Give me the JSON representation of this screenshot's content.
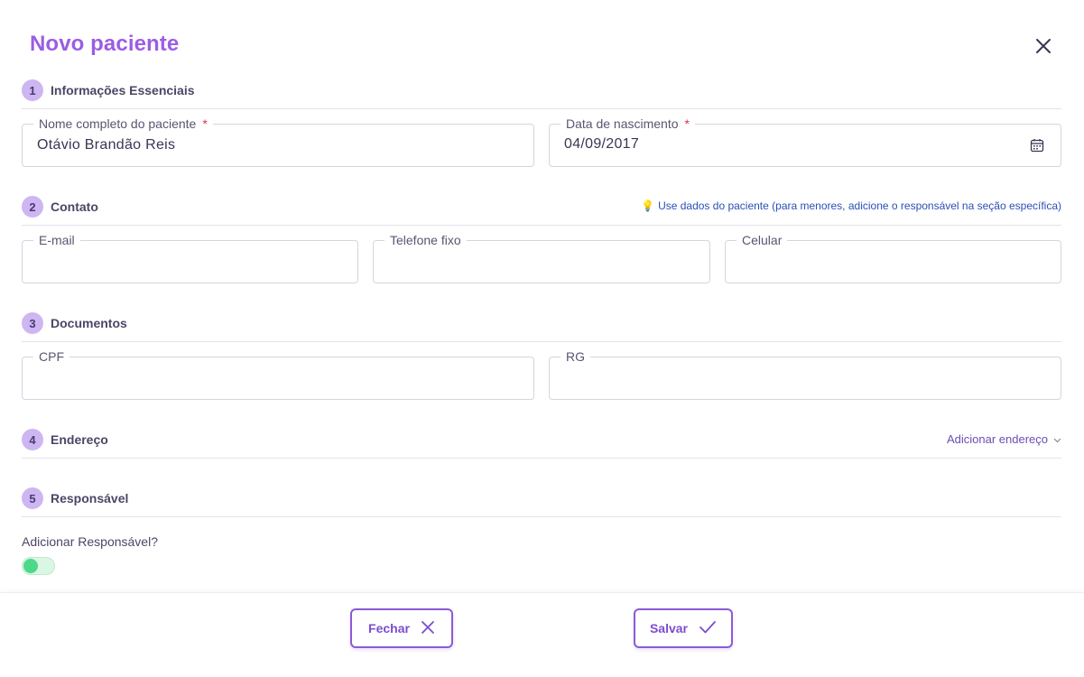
{
  "modal": {
    "title": "Novo paciente"
  },
  "sections": [
    {
      "number": "1",
      "title": "Informações Essenciais"
    },
    {
      "number": "2",
      "title": "Contato"
    },
    {
      "number": "3",
      "title": "Documentos"
    },
    {
      "number": "4",
      "title": "Endereço"
    },
    {
      "number": "5",
      "title": "Responsável"
    }
  ],
  "contact_hint": {
    "text": "Use dados do paciente (para menores, adicione o responsável na seção específica)",
    "icon": "lightbulb-icon"
  },
  "fields": {
    "full_name": {
      "label": "Nome completo do paciente",
      "required_mark": "*",
      "value": "Otávio Brandão Reis"
    },
    "birth_date": {
      "label": "Data de nascimento",
      "required_mark": "*",
      "value": "04/09/2017",
      "icon": "calendar-icon"
    },
    "email": {
      "label": "E-mail",
      "value": ""
    },
    "landline": {
      "label": "Telefone fixo",
      "value": ""
    },
    "mobile": {
      "label": "Celular",
      "value": ""
    },
    "cpf": {
      "label": "CPF",
      "value": ""
    },
    "rg": {
      "label": "RG",
      "value": ""
    }
  },
  "address": {
    "add_link": "Adicionar endereço"
  },
  "guardian": {
    "toggle_label": "Adicionar Responsável?",
    "toggle_on": false
  },
  "footer": {
    "close_label": "Fechar",
    "save_label": "Salvar"
  },
  "colors": {
    "accent": "#9b5de5",
    "button": "#7c4ccf",
    "step_badge": "#cdb6f2",
    "toggle": "#4ed88a",
    "hint": "#2a4fb8",
    "required": "#d0384a"
  }
}
